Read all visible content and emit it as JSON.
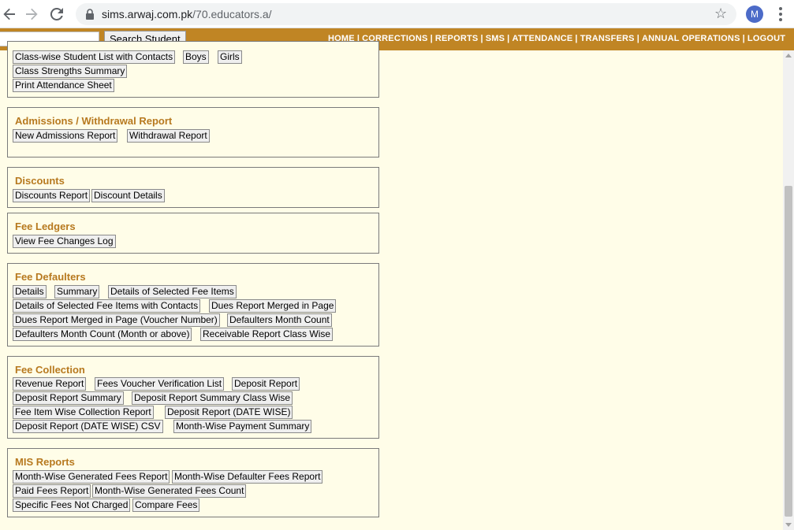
{
  "browser": {
    "url_domain": "sims.arwaj.com.pk",
    "url_path": "/70.educators.a/",
    "profile_initial": "M"
  },
  "topbar": {
    "search_button": "Search Student",
    "search_value": "",
    "menu": [
      "HOME",
      "CORRECTIONS",
      "REPORTS",
      "SMS",
      "ATTENDANCE",
      "TRANSFERS",
      "ANNUAL OPERATIONS",
      "LOGOUT"
    ],
    "separator": "|"
  },
  "sections": {
    "class": {
      "buttons": [
        "Class-wise Student List with Contacts",
        "Boys",
        "Girls",
        "Class Strengths Summary",
        "Print Attendance Sheet"
      ]
    },
    "admissions": {
      "title": "Admissions / Withdrawal Report",
      "buttons": [
        "New Admissions Report",
        "Withdrawal Report"
      ]
    },
    "discounts": {
      "title": "Discounts",
      "buttons": [
        "Discounts Report",
        "Discount Details"
      ]
    },
    "ledgers": {
      "title": "Fee Ledgers",
      "buttons": [
        "View Fee Changes Log"
      ]
    },
    "defaulters": {
      "title": "Fee Defaulters",
      "buttons": [
        "Details",
        "Summary",
        "Details of Selected Fee Items",
        "Details of Selected Fee Items with Contacts",
        "Dues Report Merged in Page",
        "Dues Report Merged in Page (Voucher Number)",
        "Defaulters Month Count",
        "Defaulters Month Count (Month or above)",
        "Receivable Report Class Wise"
      ]
    },
    "collection": {
      "title": "Fee Collection",
      "buttons": [
        "Revenue Report",
        "Fees Voucher Verification List",
        "Deposit Report",
        "Deposit Report Summary",
        "Deposit Report Summary Class Wise",
        "Fee Item Wise Collection Report",
        "Deposit Report (DATE WISE)",
        "Deposit Report (DATE WISE) CSV",
        "Month-Wise Payment Summary"
      ]
    },
    "mis": {
      "title": "MIS Reports",
      "buttons": [
        "Month-Wise Generated Fees Report",
        "Month-Wise Defaulter Fees Report",
        "Paid Fees Report",
        "Month-Wise Generated Fees Count",
        "Specific Fees Not Charged",
        "Compare Fees"
      ]
    }
  },
  "colors": {
    "header_bar": "#c08524",
    "section_title": "#b7791f",
    "page_background": "#fffde8"
  }
}
